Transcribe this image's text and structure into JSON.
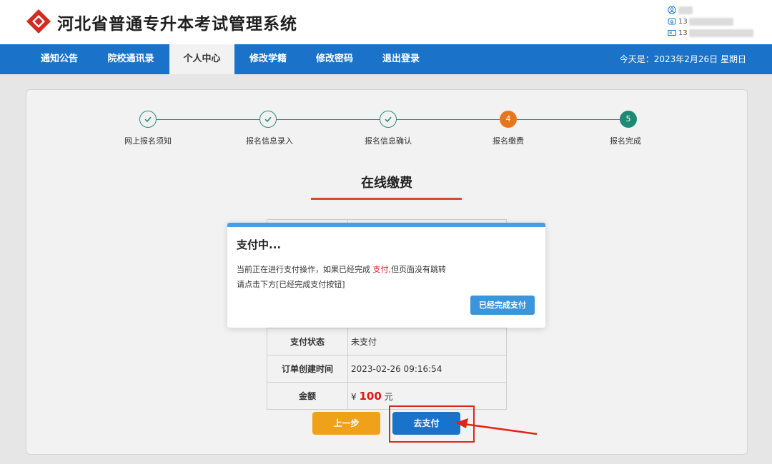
{
  "header": {
    "title": "河北省普通专升本考试管理系统",
    "user_id_prefix": "",
    "phone_prefix": "13",
    "idcard_prefix": "13"
  },
  "nav": {
    "items": [
      "通知公告",
      "院校通讯录",
      "个人中心",
      "修改学籍",
      "修改密码",
      "退出登录"
    ],
    "active_index": 2,
    "date_text": "今天是：2023年2月26日 星期日"
  },
  "stepper": {
    "steps": [
      {
        "label": "网上报名须知",
        "state": "done"
      },
      {
        "label": "报名信息录入",
        "state": "done"
      },
      {
        "label": "报名信息确认",
        "state": "done"
      },
      {
        "label": "报名缴费",
        "state": "current",
        "number": "4"
      },
      {
        "label": "报名完成",
        "state": "todo",
        "number": "5"
      }
    ]
  },
  "page": {
    "heading": "在线缴费"
  },
  "table": {
    "rows": [
      {
        "key": "支付状态",
        "value": "未支付"
      },
      {
        "key": "订单创建时间",
        "value": "2023-02-26 09:16:54"
      }
    ],
    "amount_key": "金额",
    "amount_currency": "¥",
    "amount_value": "100",
    "amount_unit": "元"
  },
  "buttons": {
    "prev": "上一步",
    "pay": "去支付"
  },
  "modal": {
    "title": "支付中...",
    "line1_before": "当前正在进行支付操作，如果已经完成 ",
    "line1_highlight": "支付,",
    "line1_after": "但页面没有跳转",
    "line2": "请点击下方[已经完成支付按钮]",
    "done_button": "已经完成支付"
  },
  "colors": {
    "nav": "#1a73c8",
    "step_done": "#2a8c74",
    "step_current": "#e8761f",
    "accent_red": "#e0161a",
    "btn_prev": "#f0a11a",
    "modal_button": "#3a95da"
  }
}
